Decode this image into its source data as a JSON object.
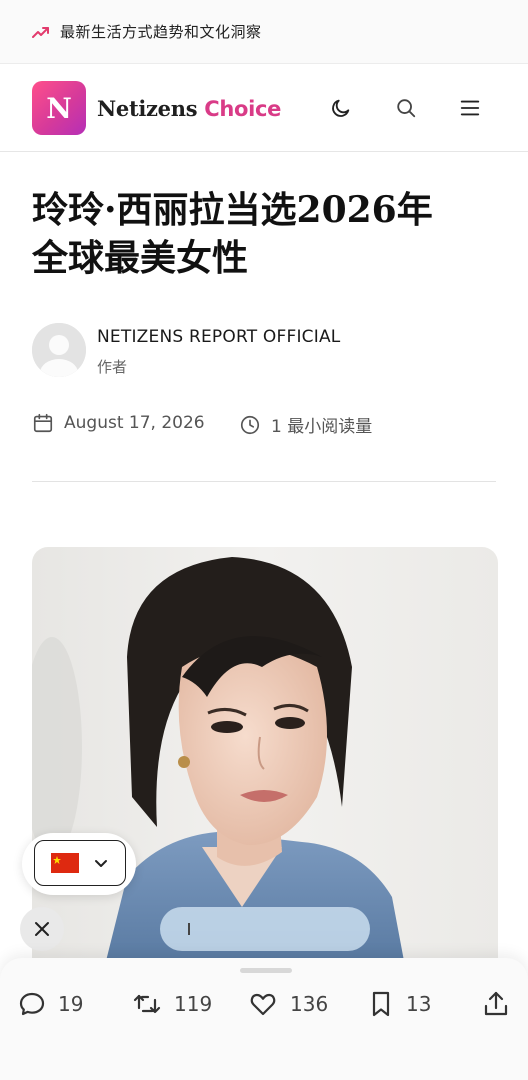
{
  "topbar": {
    "tagline": "最新生活方式趋势和文化洞察",
    "icon": "trending-up-icon",
    "icon_color": "#e23b6d"
  },
  "header": {
    "logo_letter": "N",
    "brand_main": "Netizens",
    "brand_accent": "Choice",
    "accent_color": "#d93b87",
    "icons": [
      "moon-icon",
      "search-icon",
      "menu-icon"
    ]
  },
  "article": {
    "title_line1": "玲玲·西丽拉当选2026年",
    "title_line2": "全球最美女性",
    "author": {
      "name": "NETIZENS REPORT OFFICIAL",
      "role": "作者"
    },
    "date": "August 17, 2026",
    "reading_time": "1 最小阅读量"
  },
  "overlay": {
    "language_flag": "china-flag-icon",
    "language_flag_color": "#de2910"
  },
  "actions": {
    "comments": "19",
    "reposts": "119",
    "likes": "136",
    "bookmarks": "13",
    "share_icon": "share-icon"
  }
}
